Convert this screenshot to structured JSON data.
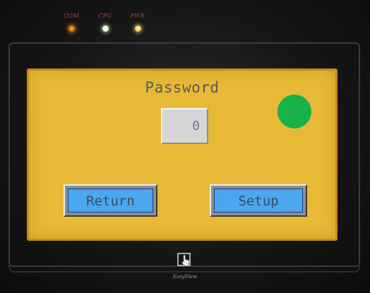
{
  "indicators": [
    {
      "label": "COM",
      "color": "#ff9a3c"
    },
    {
      "label": "CPU",
      "color": "#f2f8d8"
    },
    {
      "label": "PWR",
      "color": "#ffd28a"
    }
  ],
  "screen": {
    "background": "#e7b934",
    "title": "Password",
    "password_value": "0",
    "status_indicator_color": "#18b24a",
    "buttons": {
      "return_label": "Return",
      "setup_label": "Setup"
    }
  },
  "device": {
    "logo_icon": "hand-pointer-icon",
    "brand": "EasyView"
  }
}
